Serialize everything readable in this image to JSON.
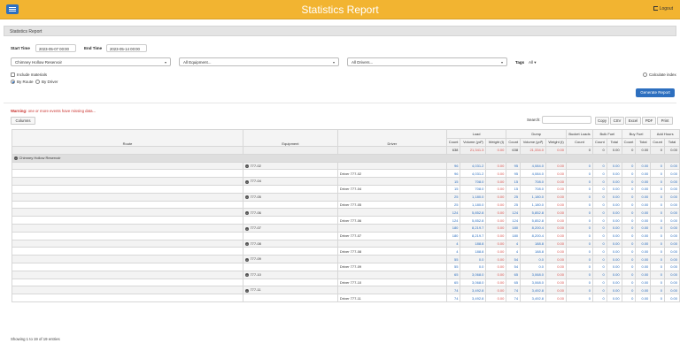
{
  "header": {
    "title": "Statistics Report",
    "logout_label": "Logout"
  },
  "panel": {
    "title": "Statistics Report"
  },
  "filters": {
    "start_label": "Start Time",
    "start_value": "2023-05-07 00:00",
    "end_label": "End Time",
    "end_value": "2023-05-14 00:00",
    "site_value": "Chimney Hollow Reservoir",
    "equipment_value": "All Equipment...",
    "drivers_value": "All Drivers...",
    "tags_label": "Tags",
    "tags_value": "All",
    "include_materials": "Include materials",
    "calculate_index": "Calculate index",
    "by_route": "By Route",
    "by_driver": "By Driver",
    "generate_label": "Generate Report"
  },
  "warning": {
    "prefix": "Warning:",
    "text": "one or more events have missing data..."
  },
  "toolbar": {
    "columns_label": "Columns",
    "search_label": "Search:",
    "copy_label": "Copy",
    "csv_label": "CSV",
    "excel_label": "Excel",
    "pdf_label": "PDF",
    "print_label": "Print"
  },
  "table": {
    "headers": {
      "route": "Route",
      "equipment": "Equipment",
      "driver": "Driver",
      "load": "Load",
      "dump": "Dump",
      "bucket": "Bucket Loads",
      "bulk": "Bulk Fuel",
      "buy": "Buy Fuel",
      "add": "Add Hours",
      "count": "Count",
      "volume": "Volume (yd³)",
      "weight": "Weight (t)",
      "total": "Total"
    },
    "group": {
      "name": "Chimney Hollow Reservoir"
    },
    "summary": {
      "lcount": "638",
      "lvol": "21,341.3",
      "lwt": "0.00",
      "dcount": "638",
      "dvol": "21,334.0",
      "dwt": "0.00",
      "bucket": "0",
      "bcount": "0",
      "btotal": "0.00",
      "ycount": "0",
      "ytotal": "0.00",
      "acount": "0",
      "atotal": "0.00"
    },
    "rows": [
      {
        "equip": "777-02",
        "driver": "",
        "lcount": "96",
        "lvol": "4,031.2",
        "lwt": "0.00",
        "dcount": "95",
        "dvol": "4,084.0",
        "dwt": "0.00",
        "bucket": "0",
        "bcount": "0",
        "btotal": "0.00",
        "ycount": "0",
        "ytotal": "0.00",
        "acount": "0",
        "atotal": "0.00"
      },
      {
        "equip": "",
        "driver": "Driver 777-02",
        "lcount": "96",
        "lvol": "4,031.2",
        "lwt": "0.00",
        "dcount": "95",
        "dvol": "4,084.0",
        "dwt": "0.00",
        "bucket": "0",
        "bcount": "0",
        "btotal": "0.00",
        "ycount": "0",
        "ytotal": "0.00",
        "acount": "0",
        "atotal": "0.00"
      },
      {
        "equip": "777-04",
        "driver": "",
        "lcount": "15",
        "lvol": "708.0",
        "lwt": "0.00",
        "dcount": "15",
        "dvol": "708.0",
        "dwt": "0.00",
        "bucket": "0",
        "bcount": "0",
        "btotal": "0.00",
        "ycount": "0",
        "ytotal": "0.00",
        "acount": "0",
        "atotal": "0.00"
      },
      {
        "equip": "",
        "driver": "Driver 777-04",
        "lcount": "15",
        "lvol": "708.0",
        "lwt": "0.00",
        "dcount": "15",
        "dvol": "708.0",
        "dwt": "0.00",
        "bucket": "0",
        "bcount": "0",
        "btotal": "0.00",
        "ycount": "0",
        "ytotal": "0.00",
        "acount": "0",
        "atotal": "0.00"
      },
      {
        "equip": "777-05",
        "driver": "",
        "lcount": "25",
        "lvol": "1,180.0",
        "lwt": "0.00",
        "dcount": "25",
        "dvol": "1,180.0",
        "dwt": "0.00",
        "bucket": "0",
        "bcount": "0",
        "btotal": "0.00",
        "ycount": "0",
        "ytotal": "0.00",
        "acount": "0",
        "atotal": "0.00"
      },
      {
        "equip": "",
        "driver": "Driver 777-05",
        "lcount": "25",
        "lvol": "1,180.0",
        "lwt": "0.00",
        "dcount": "25",
        "dvol": "1,180.0",
        "dwt": "0.00",
        "bucket": "0",
        "bcount": "0",
        "btotal": "0.00",
        "ycount": "0",
        "ytotal": "0.00",
        "acount": "0",
        "atotal": "0.00"
      },
      {
        "equip": "777-06",
        "driver": "",
        "lcount": "124",
        "lvol": "5,852.8",
        "lwt": "0.00",
        "dcount": "124",
        "dvol": "5,852.8",
        "dwt": "0.00",
        "bucket": "0",
        "bcount": "0",
        "btotal": "0.00",
        "ycount": "0",
        "ytotal": "0.00",
        "acount": "0",
        "atotal": "0.00"
      },
      {
        "equip": "",
        "driver": "Driver 777-06",
        "lcount": "124",
        "lvol": "5,852.8",
        "lwt": "0.00",
        "dcount": "124",
        "dvol": "5,852.8",
        "dwt": "0.00",
        "bucket": "0",
        "bcount": "0",
        "btotal": "0.00",
        "ycount": "0",
        "ytotal": "0.00",
        "acount": "0",
        "atotal": "0.00"
      },
      {
        "equip": "777-07",
        "driver": "",
        "lcount": "180",
        "lvol": "8,219.7",
        "lwt": "0.00",
        "dcount": "180",
        "dvol": "8,200.4",
        "dwt": "0.00",
        "bucket": "0",
        "bcount": "0",
        "btotal": "0.00",
        "ycount": "0",
        "ytotal": "0.00",
        "acount": "0",
        "atotal": "0.00"
      },
      {
        "equip": "",
        "driver": "Driver 777-07",
        "lcount": "180",
        "lvol": "8,219.7",
        "lwt": "0.00",
        "dcount": "180",
        "dvol": "8,200.4",
        "dwt": "0.00",
        "bucket": "0",
        "bcount": "0",
        "btotal": "0.00",
        "ycount": "0",
        "ytotal": "0.00",
        "acount": "0",
        "atotal": "0.00"
      },
      {
        "equip": "777-08",
        "driver": "",
        "lcount": "4",
        "lvol": "188.8",
        "lwt": "0.00",
        "dcount": "4",
        "dvol": "188.8",
        "dwt": "0.00",
        "bucket": "0",
        "bcount": "0",
        "btotal": "0.00",
        "ycount": "0",
        "ytotal": "0.00",
        "acount": "0",
        "atotal": "0.00"
      },
      {
        "equip": "",
        "driver": "Driver 777-08",
        "lcount": "4",
        "lvol": "188.8",
        "lwt": "0.00",
        "dcount": "4",
        "dvol": "188.8",
        "dwt": "0.00",
        "bucket": "0",
        "bcount": "0",
        "btotal": "0.00",
        "ycount": "0",
        "ytotal": "0.00",
        "acount": "0",
        "atotal": "0.00"
      },
      {
        "equip": "777-09",
        "driver": "",
        "lcount": "55",
        "lvol": "0.0",
        "lwt": "0.00",
        "dcount": "54",
        "dvol": "0.0",
        "dwt": "0.00",
        "bucket": "0",
        "bcount": "0",
        "btotal": "0.00",
        "ycount": "0",
        "ytotal": "0.00",
        "acount": "0",
        "atotal": "0.00"
      },
      {
        "equip": "",
        "driver": "Driver 777-09",
        "lcount": "55",
        "lvol": "0.0",
        "lwt": "0.00",
        "dcount": "54",
        "dvol": "0.0",
        "dwt": "0.00",
        "bucket": "0",
        "bcount": "0",
        "btotal": "0.00",
        "ycount": "0",
        "ytotal": "0.00",
        "acount": "0",
        "atotal": "0.00"
      },
      {
        "equip": "777-10",
        "driver": "",
        "lcount": "65",
        "lvol": "3,068.0",
        "lwt": "0.00",
        "dcount": "65",
        "dvol": "3,068.0",
        "dwt": "0.00",
        "bucket": "0",
        "bcount": "0",
        "btotal": "0.00",
        "ycount": "0",
        "ytotal": "0.00",
        "acount": "0",
        "atotal": "0.00"
      },
      {
        "equip": "",
        "driver": "Driver 777-10",
        "lcount": "65",
        "lvol": "3,068.0",
        "lwt": "0.00",
        "dcount": "65",
        "dvol": "3,068.0",
        "dwt": "0.00",
        "bucket": "0",
        "bcount": "0",
        "btotal": "0.00",
        "ycount": "0",
        "ytotal": "0.00",
        "acount": "0",
        "atotal": "0.00"
      },
      {
        "equip": "777-11",
        "driver": "",
        "lcount": "74",
        "lvol": "3,492.8",
        "lwt": "0.00",
        "dcount": "74",
        "dvol": "3,492.8",
        "dwt": "0.00",
        "bucket": "0",
        "bcount": "0",
        "btotal": "0.00",
        "ycount": "0",
        "ytotal": "0.00",
        "acount": "0",
        "atotal": "0.00"
      },
      {
        "equip": "",
        "driver": "Driver 777-11",
        "lcount": "74",
        "lvol": "3,492.8",
        "lwt": "0.00",
        "dcount": "74",
        "dvol": "3,492.8",
        "dwt": "0.00",
        "bucket": "0",
        "bcount": "0",
        "btotal": "0.00",
        "ycount": "0",
        "ytotal": "0.00",
        "acount": "0",
        "atotal": "0.00"
      }
    ]
  },
  "footer": {
    "info": "Showing 1 to 19 of 19 entries"
  }
}
